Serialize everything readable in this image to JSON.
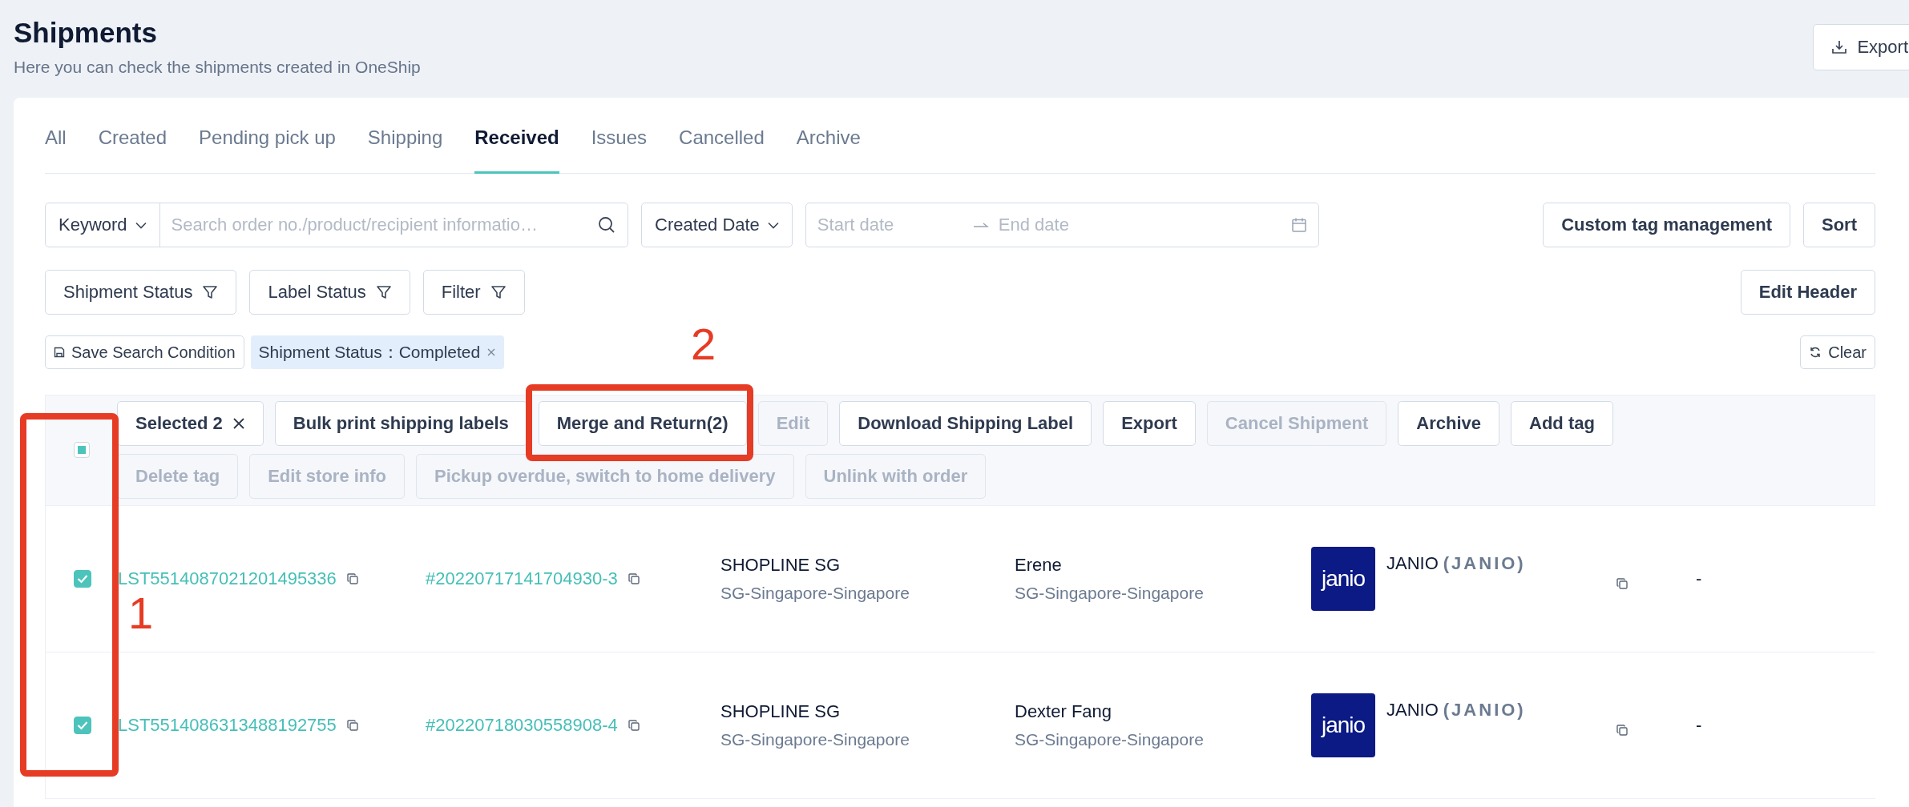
{
  "header": {
    "title": "Shipments",
    "subtitle": "Here you can check the shipments created in OneShip",
    "export_button": "Export"
  },
  "tabs": [
    {
      "label": "All",
      "selected": false
    },
    {
      "label": "Created",
      "selected": false
    },
    {
      "label": "Pending pick up",
      "selected": false
    },
    {
      "label": "Shipping",
      "selected": false
    },
    {
      "label": "Received",
      "selected": true
    },
    {
      "label": "Issues",
      "selected": false
    },
    {
      "label": "Cancelled",
      "selected": false
    },
    {
      "label": "Archive",
      "selected": false
    }
  ],
  "search": {
    "field_select": "Keyword",
    "placeholder": "Search order no./product/recipient informatio…",
    "date_select": "Created Date",
    "start_placeholder": "Start date",
    "end_placeholder": "End date"
  },
  "top_buttons": [
    "Custom tag management",
    "Sort"
  ],
  "filters": [
    "Shipment Status",
    "Label Status",
    "Filter"
  ],
  "edit_header_button": "Edit Header",
  "save_search_button": "Save Search Condition",
  "active_filters": [
    "Shipment Status：Completed"
  ],
  "clear_button": "Clear",
  "bulk": {
    "select_all_indeterminate": true,
    "selected_label": "Selected 2",
    "action_rows": [
      [
        {
          "label": "Bulk print shipping labels",
          "disabled": false
        },
        {
          "label": "Merge and Return(2)",
          "disabled": false
        },
        {
          "label": "Edit",
          "disabled": true
        },
        {
          "label": "Download Shipping Label",
          "disabled": false
        },
        {
          "label": "Export",
          "disabled": false
        },
        {
          "label": "Cancel Shipment",
          "disabled": true
        },
        {
          "label": "Archive",
          "disabled": false
        },
        {
          "label": "Add tag",
          "disabled": false
        }
      ],
      [
        {
          "label": "Delete tag",
          "disabled": true
        },
        {
          "label": "Edit store info",
          "disabled": true
        },
        {
          "label": "Pickup overdue, switch to home delivery",
          "disabled": true
        },
        {
          "label": "Unlink with order",
          "disabled": true
        }
      ]
    ]
  },
  "rows": [
    {
      "selected": true,
      "shipment_no": "LST5514087021201495336",
      "order_no": "#20220717141704930-3",
      "store": "SHOPLINE SG",
      "store_location": "SG-Singapore-Singapore",
      "recipient": "Erene",
      "recipient_location": "SG-Singapore-Singapore",
      "logo_text": "janio",
      "carrier": "JANIO",
      "carrier_code": "(JANIO)",
      "column_7": "-"
    },
    {
      "selected": true,
      "shipment_no": "LST5514086313488192755",
      "order_no": "#20220718030558908-4",
      "store": "SHOPLINE SG",
      "store_location": "SG-Singapore-Singapore",
      "recipient": "Dexter Fang",
      "recipient_location": "SG-Singapore-Singapore",
      "logo_text": "janio",
      "carrier": "JANIO",
      "carrier_code": "(JANIO)",
      "column_7": "-"
    }
  ],
  "annotations": [
    {
      "label": "1"
    },
    {
      "label": "2"
    }
  ]
}
